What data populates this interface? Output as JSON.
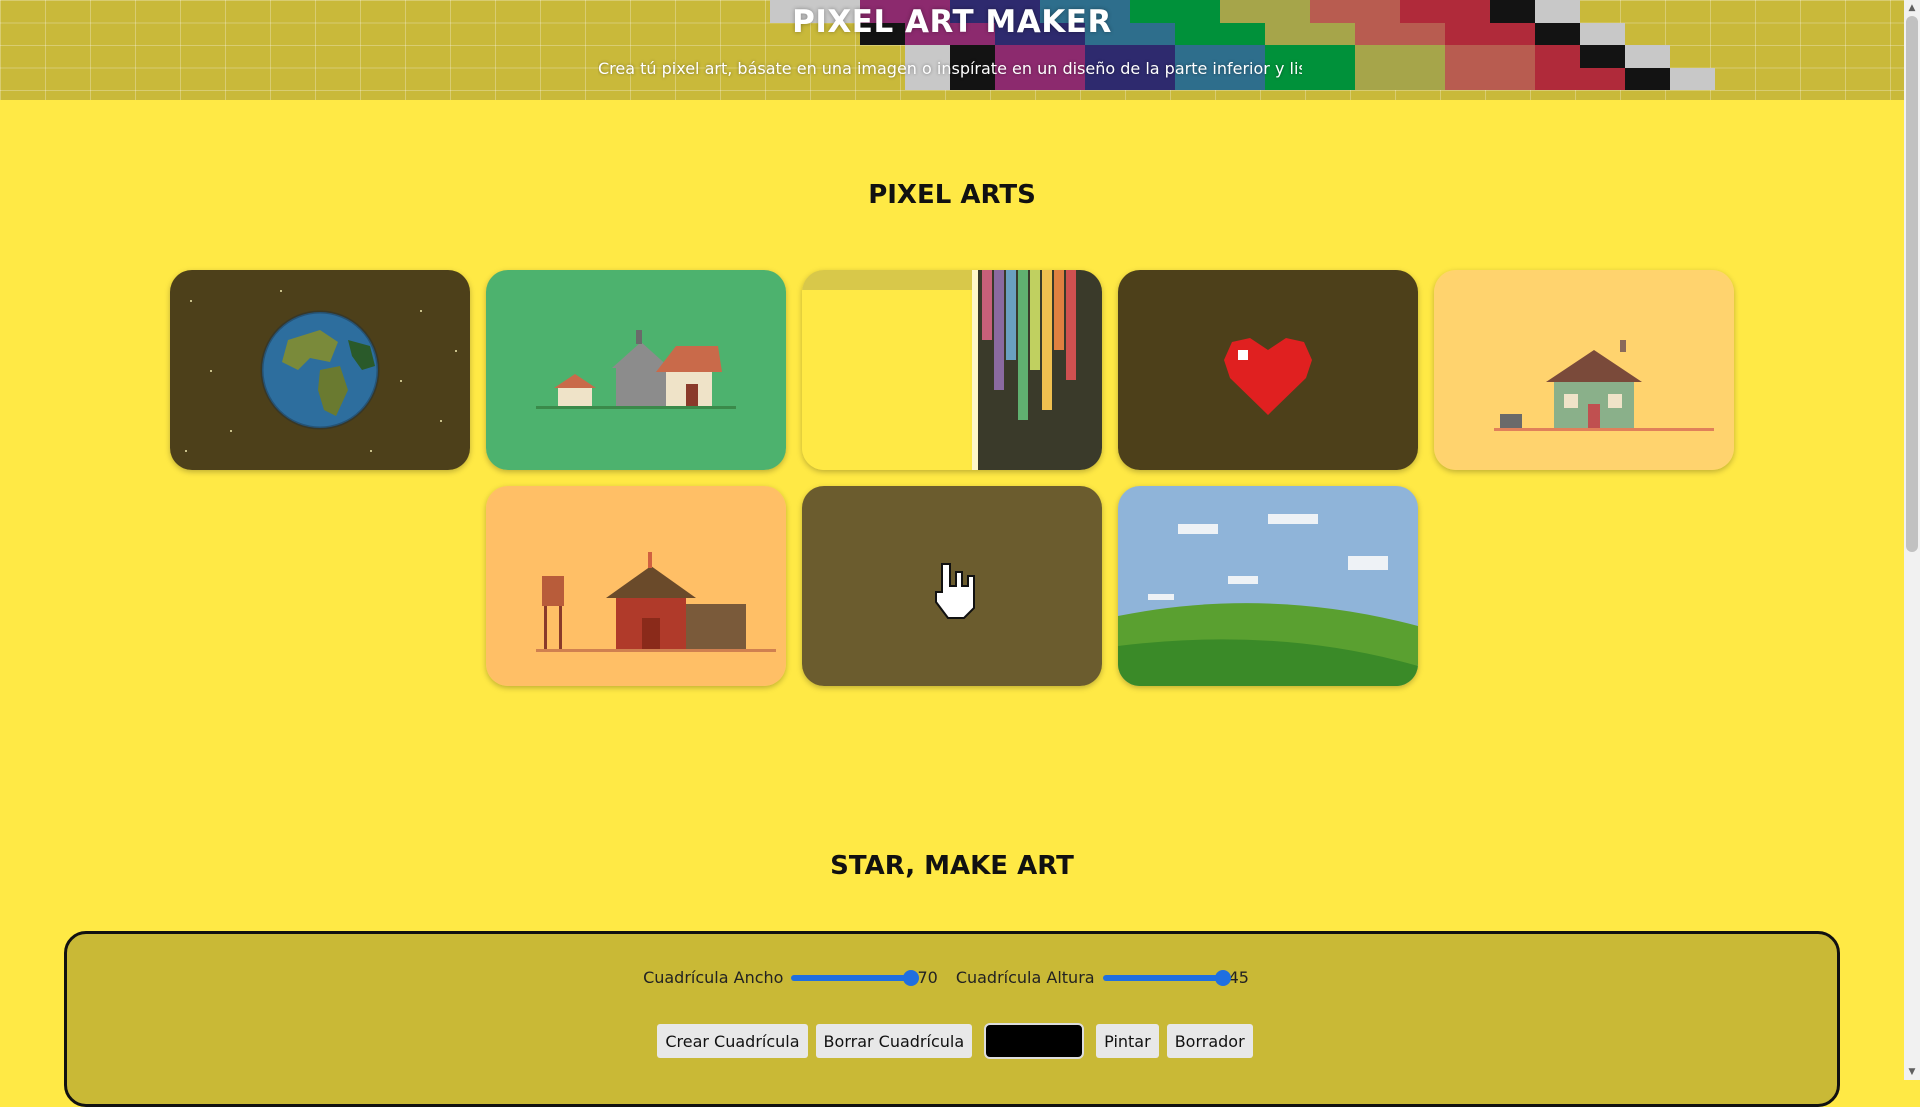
{
  "header": {
    "title": "PIXEL ART MAKER",
    "subtitle": "Crea tú pixel art, básate en una imagen o inspírate en un diseño de la parte inferior y listo. Exp"
  },
  "gallery": {
    "heading": "PIXEL ARTS",
    "items": [
      {
        "name": "earth-art",
        "bg": "#4d401a"
      },
      {
        "name": "cottage-art",
        "bg": "#4db26e"
      },
      {
        "name": "rainbow-drip-art",
        "bg": "#ffe945"
      },
      {
        "name": "heart-art",
        "bg": "#4d401a"
      },
      {
        "name": "house-art",
        "bg": "#ffd36e"
      },
      {
        "name": "barn-art",
        "bg": "#ffbf66"
      },
      {
        "name": "hand-cursor-art",
        "bg": "#6b5c2e"
      },
      {
        "name": "landscape-art",
        "bg": "#8fb4d9"
      }
    ]
  },
  "maker": {
    "heading": "STAR, MAKE ART",
    "grid_width_label": "Cuadrícula Ancho",
    "grid_width_value": "70",
    "grid_height_label": "Cuadrícula Altura",
    "grid_height_value": "45",
    "slider_fraction": 1.0,
    "create_grid_button": "Crear Cuadrícula",
    "clear_grid_button": "Borrar Cuadrícula",
    "current_color": "#000000",
    "paint_button": "Pintar",
    "eraser_button": "Borrador"
  },
  "colors": {
    "page_bg": "#ffe945",
    "panel_bg": "#c9b936",
    "header_bg": "#c9b93a",
    "accent": "#1f6fe0"
  }
}
